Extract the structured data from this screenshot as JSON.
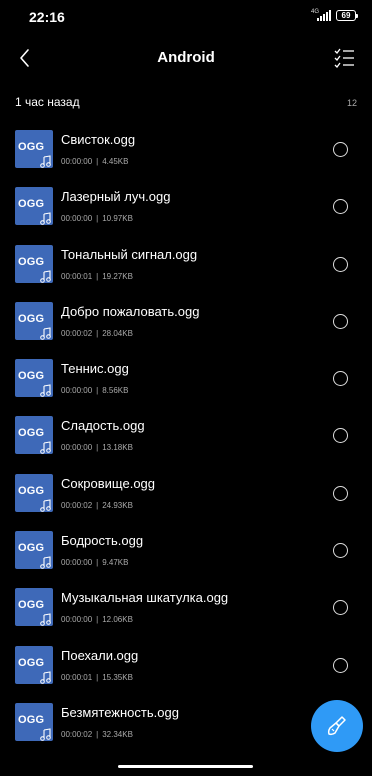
{
  "status_bar": {
    "time": "22:16",
    "network": "4G",
    "battery": "69"
  },
  "header": {
    "title": "Android",
    "back_icon": "chevron-left-icon",
    "select_icon": "checklist-icon"
  },
  "section": {
    "title": "1 час назад",
    "count": "12"
  },
  "file_icon_label": "OGG",
  "files": [
    {
      "name": "Свисток.ogg",
      "duration": "00:00:00",
      "size": "4.45KB"
    },
    {
      "name": "Лазерный луч.ogg",
      "duration": "00:00:00",
      "size": "10.97KB"
    },
    {
      "name": "Тональный сигнал.ogg",
      "duration": "00:00:01",
      "size": "19.27KB"
    },
    {
      "name": "Добро пожаловать.ogg",
      "duration": "00:00:02",
      "size": "28.04KB"
    },
    {
      "name": "Теннис.ogg",
      "duration": "00:00:00",
      "size": "8.56KB"
    },
    {
      "name": "Сладость.ogg",
      "duration": "00:00:00",
      "size": "13.18KB"
    },
    {
      "name": "Сокровище.ogg",
      "duration": "00:00:02",
      "size": "24.93KB"
    },
    {
      "name": "Бодрость.ogg",
      "duration": "00:00:00",
      "size": "9.47KB"
    },
    {
      "name": "Музыкальная шкатулка.ogg",
      "duration": "00:00:00",
      "size": "12.06KB"
    },
    {
      "name": "Поехали.ogg",
      "duration": "00:00:01",
      "size": "15.35KB"
    },
    {
      "name": "Безмятежность.ogg",
      "duration": "00:00:02",
      "size": "32.34KB"
    }
  ],
  "fab": {
    "icon": "broom-clean-icon",
    "color": "#2f9af6"
  },
  "colors": {
    "background": "#000000",
    "file_icon_bg": "#3e69b8",
    "accent": "#2f9af6"
  }
}
